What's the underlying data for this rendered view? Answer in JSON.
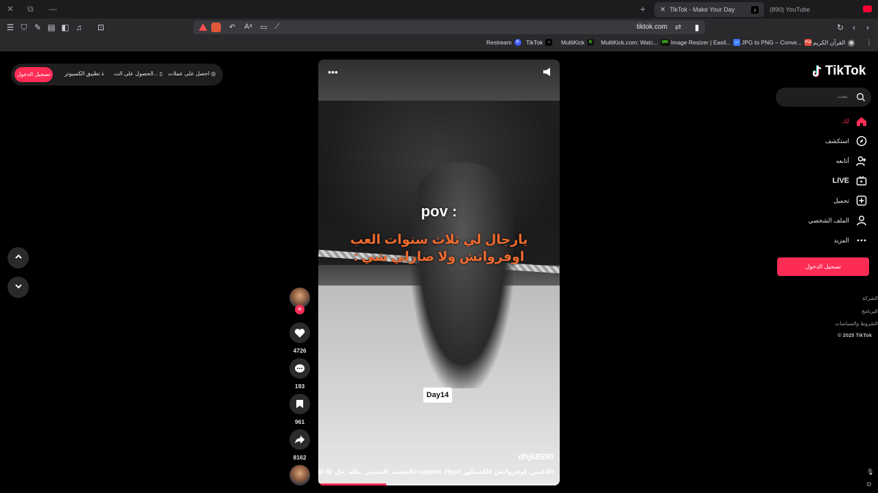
{
  "browser": {
    "tabs": [
      {
        "label": "TikTok - Make Your Day",
        "active": true
      },
      {
        "label": "(890) YouTube",
        "active": false
      }
    ],
    "url": "tiktok.com",
    "bookmarks": [
      {
        "label": "Restream",
        "icon": "R",
        "color": "#3b5bff"
      },
      {
        "label": "TikTok",
        "icon": "♪",
        "color": "#000000"
      },
      {
        "label": "MultiKick",
        "icon": "K",
        "color": "#53fc18"
      },
      {
        "label": "MultiKick.com: Watc...",
        "icon": "MK",
        "color": "#53fc18"
      },
      {
        "label": "Image Resizer | Easil...",
        "icon": "▭",
        "color": "#3d7cff"
      },
      {
        "label": "JPG to PNG – Conve...",
        "icon": "PNG",
        "color": "#e44d3a"
      },
      {
        "label": "القرآن الكريم",
        "icon": "◉",
        "color": "#9a9a9a"
      }
    ]
  },
  "top_pill": {
    "login": "تسجيل الدخول",
    "desktop_app": "تطبيق الكمبيوتر",
    "get_app": "الحصول على الت...",
    "get_coins": "احصل على عملات"
  },
  "video": {
    "pov": "pov :",
    "caption_line1": "يارجال لي ثلاث سنوات العب",
    "caption_line2": "اوفرواتش ولا صارلي شي :",
    "day_label": "Day14",
    "username": "dhjk8590",
    "description": "#لاعبين_اوفرواتش #اكسبلور #explore #fyp #الشعب_الصيني_ماله_حل 😂😂😂",
    "progress": 0.28
  },
  "actions": {
    "likes": "4726",
    "comments": "193",
    "saves": "961",
    "shares": "8162"
  },
  "sidebar": {
    "brand": "TikTok",
    "search_placeholder": "بحث",
    "items": [
      {
        "label": "لك",
        "icon": "home-icon"
      },
      {
        "label": "استكشف",
        "icon": "compass-icon"
      },
      {
        "label": "أتابعه",
        "icon": "following-icon"
      },
      {
        "label": "LIVE",
        "icon": "live-icon"
      },
      {
        "label": "تحميل",
        "icon": "upload-icon"
      },
      {
        "label": "الملف الشخصي",
        "icon": "profile-icon"
      },
      {
        "label": "المزيد",
        "icon": "more-icon"
      }
    ],
    "login_button": "تسجيل الدخول",
    "footer": [
      "الشركة",
      "البرنامج",
      "الشروط والسياسات",
      "© 2025 TikTok"
    ],
    "accent": "#fe2c55"
  }
}
